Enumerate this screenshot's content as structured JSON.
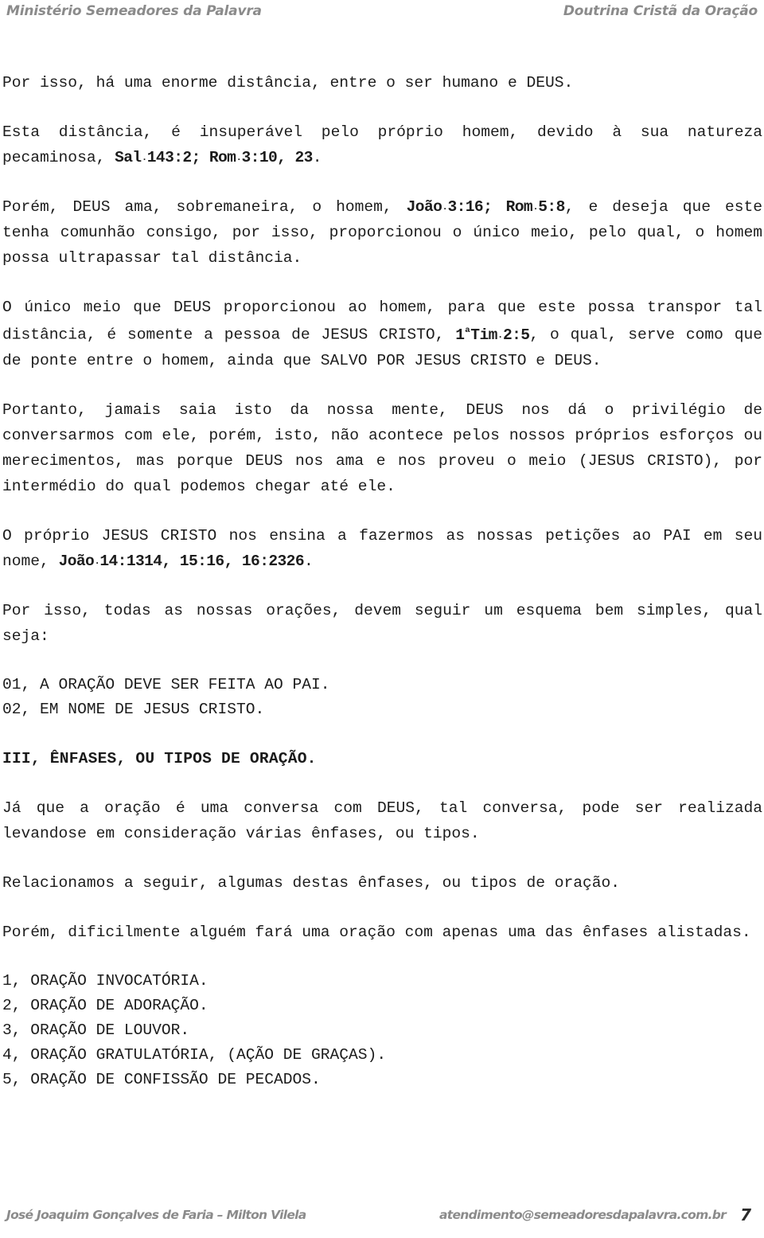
{
  "header": {
    "left": "Ministério Semeadores da Palavra",
    "right": "Doutrina Cristã da Oração"
  },
  "body": {
    "p1": "Por isso, há uma enorme distância, entre o ser humano e DEUS.",
    "p2_a": "Esta distância, é insuperável pelo próprio homem, devido à sua natureza pecaminosa, ",
    "p2_ref1_book": "Sal",
    "p2_ref1_verse": "143:2; ",
    "p2_ref2_book": "Rom",
    "p2_ref2_verse": "3:10, 23",
    "p2_b": ".",
    "p3_a": "Porém, DEUS ama, sobremaneira, o homem, ",
    "p3_ref1_book": "João",
    "p3_ref1_verse": "3:16; ",
    "p3_ref2_book": "Rom",
    "p3_ref2_verse": "5:8",
    "p3_b": ", e deseja que este tenha comunhão consigo, por isso, proporcionou o único meio, pelo qual, o homem possa ultrapassar tal distância.",
    "p4_a": "O único meio que DEUS proporcionou ao homem, para que este possa transpor tal distância, é somente a pessoa de JESUS CRISTO, ",
    "p4_ref_num": "1",
    "p4_ref_ord": "ª",
    "p4_ref_book": "Tim",
    "p4_ref_verse": "2:5",
    "p4_b": ", o qual, serve como que de ponte entre o homem, ainda que SALVO POR JESUS CRISTO e DEUS.",
    "p5": "Portanto, jamais saia isto da nossa mente, DEUS nos dá o privilégio de conversarmos com ele, porém, isto, não acontece pelos nossos próprios esforços ou merecimentos, mas porque DEUS nos ama e nos proveu o meio (JESUS CRISTO), por intermédio do qual podemos chegar até ele.",
    "p6_a": "O próprio JESUS CRISTO nos ensina a fazermos as nossas petições ao PAI em seu nome, ",
    "p6_ref_book": "João",
    "p6_ref_verse": "14:1314, 15:16, 16:2326",
    "p6_b": ".",
    "p7": "Por isso, todas as nossas orações, devem seguir um esquema bem simples, qual seja:",
    "scheme_list": [
      "01, A ORAÇÃO DEVE SER FEITA AO PAI.",
      "02, EM NOME DE JESUS CRISTO."
    ],
    "heading3": "III, ÊNFASES, OU TIPOS DE ORAÇÃO.",
    "p8": "Já que a oração é uma conversa com DEUS, tal conversa, pode ser realizada levandose em consideração várias ênfases, ou tipos.",
    "p9": "Relacionamos a seguir, algumas destas ênfases, ou tipos de oração.",
    "p10": "Porém, dificilmente alguém fará uma oração com apenas uma das ênfases alistadas.",
    "types_list": [
      "1, ORAÇÃO INVOCATÓRIA.",
      "2, ORAÇÃO DE ADORAÇÃO.",
      "3, ORAÇÃO DE LOUVOR.",
      "4, ORAÇÃO GRATULATÓRIA, (AÇÃO DE GRAÇAS).",
      "5, ORAÇÃO DE CONFISSÃO DE PECADOS."
    ]
  },
  "footer": {
    "authors": "José Joaquim Gonçalves de Faria – Milton Vilela",
    "email": "atendimento@semeadoresdapalavra.com.br",
    "page_number": "7"
  },
  "colors": {
    "header_gray": "#8b8b8b",
    "body_text": "#1c1c1c",
    "page_number": "#2b2b2b",
    "background": "#ffffff"
  }
}
